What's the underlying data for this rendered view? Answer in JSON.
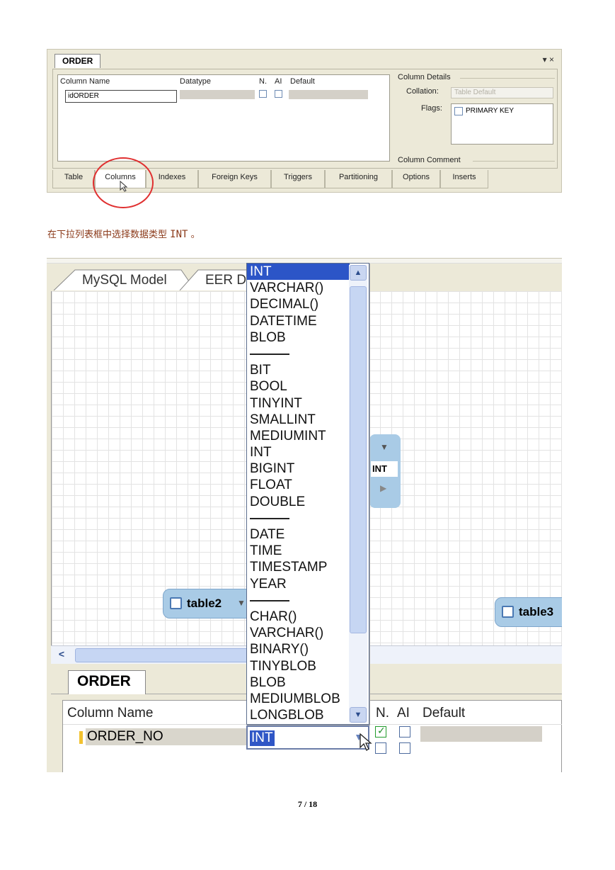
{
  "screenshot1": {
    "tab_title": "ORDER",
    "window_controls": "▾ ×",
    "headers": {
      "column_name": "Column Name",
      "datatype": "Datatype",
      "nn": "N.",
      "ai": "AI",
      "default": "Default"
    },
    "row": {
      "column_name": "idORDER"
    },
    "details": {
      "column_details": "Column Details",
      "collation_label": "Collation:",
      "collation_value": "Table Default",
      "flags_label": "Flags:",
      "flag_primary_key": "PRIMARY KEY",
      "column_comment": "Column Comment"
    },
    "bottom_tabs": [
      "Table",
      "Columns",
      "Indexes",
      "Foreign Keys",
      "Triggers",
      "Partitioning",
      "Options",
      "Inserts"
    ],
    "active_tab": "Columns"
  },
  "caption": {
    "text": "在下拉列表框中选择数据类型 ",
    "code": "INT",
    "suffix": " 。"
  },
  "screenshot2": {
    "tabs": [
      "MySQL Model",
      "EER D"
    ],
    "dropdown_items": [
      "INT",
      "VARCHAR()",
      "DECIMAL()",
      "DATETIME",
      "BLOB",
      "---",
      "BIT",
      "BOOL",
      "TINYINT",
      "SMALLINT",
      "MEDIUMINT",
      "INT",
      "BIGINT",
      "FLOAT",
      "DOUBLE",
      "---",
      "DATE",
      "TIME",
      "TIMESTAMP",
      "YEAR",
      "---",
      "CHAR()",
      "VARCHAR()",
      "BINARY()",
      "TINYBLOB",
      "BLOB",
      "MEDIUMBLOB",
      "LONGBLOB"
    ],
    "dropdown_selected_index": 0,
    "entities": {
      "table2": "table2",
      "table3": "table3"
    },
    "mini_table_value": "INT",
    "lower_tab": "ORDER",
    "headers": {
      "column_name": "Column Name",
      "nn": "N.",
      "ai": "AI",
      "default": "Default"
    },
    "row": {
      "column_name": "ORDER_NO",
      "datatype": "INT",
      "nn_checked": true,
      "ai_checked": false
    }
  },
  "page_number": "7 / 18"
}
